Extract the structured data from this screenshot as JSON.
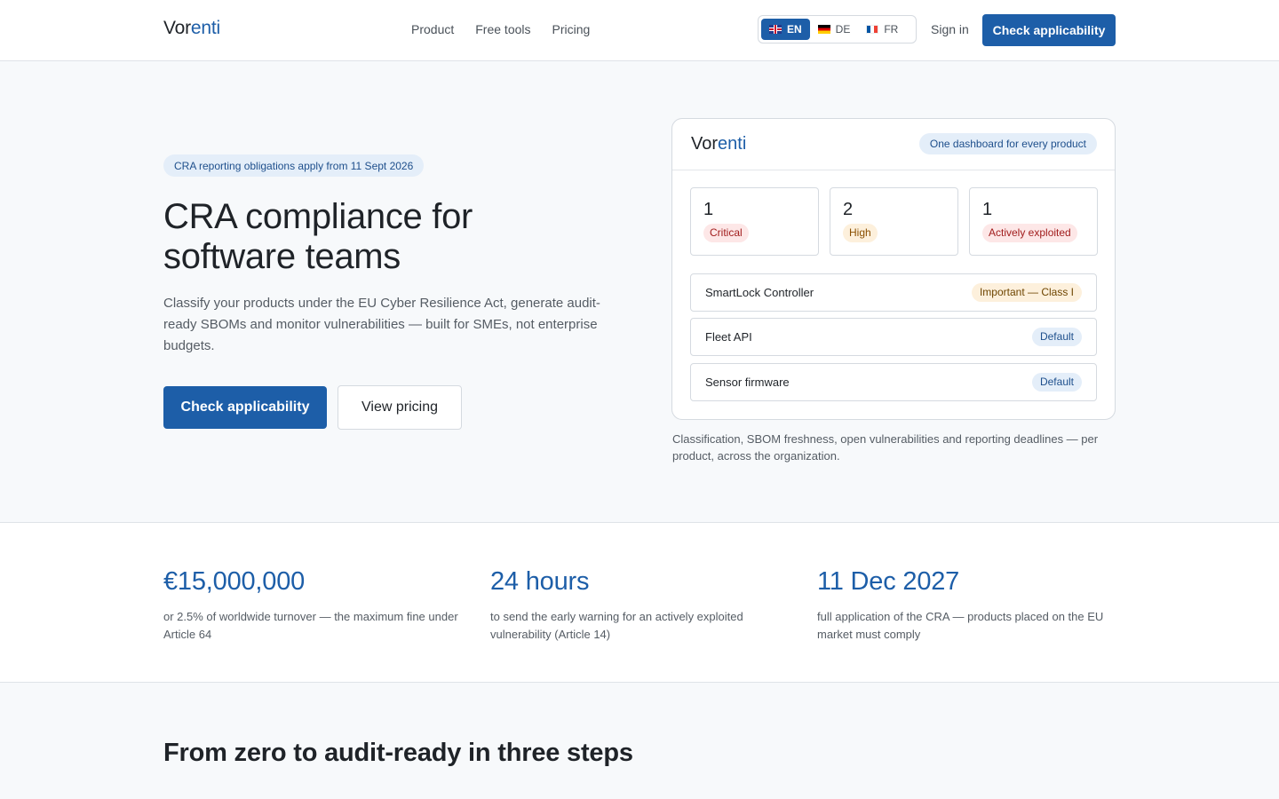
{
  "header": {
    "logo_part1": "Vor",
    "logo_part2": "enti",
    "nav": [
      "Product",
      "Free tools",
      "Pricing"
    ],
    "languages": [
      {
        "code": "EN",
        "flag": "uk-flag",
        "active": true
      },
      {
        "code": "DE",
        "flag": "de-flag",
        "active": false
      },
      {
        "code": "FR",
        "flag": "fr-flag",
        "active": false
      }
    ],
    "sign_in": "Sign in",
    "cta": "Check applicability"
  },
  "hero": {
    "pill": "CRA reporting obligations apply from 11 Sept 2026",
    "title": "CRA compliance for software teams",
    "subtitle": "Classify your products under the EU Cyber Resilience Act, generate audit-ready SBOMs and monitor vulnerabilities — built for SMEs, not enterprise budgets.",
    "primary_cta": "Check applicability",
    "secondary_cta": "View pricing"
  },
  "dashboard": {
    "logo_part1": "Vor",
    "logo_part2": "enti",
    "pill": "One dashboard for every product",
    "stats": [
      {
        "value": "1",
        "label": "Critical"
      },
      {
        "value": "2",
        "label": "High"
      },
      {
        "value": "1",
        "label": "Actively exploited"
      }
    ],
    "products": [
      {
        "name": "SmartLock Controller",
        "tag": "Important — Class I"
      },
      {
        "name": "Fleet API",
        "tag": "Default"
      },
      {
        "name": "Sensor firmware",
        "tag": "Default"
      }
    ],
    "caption": "Classification, SBOM freshness, open vulnerabilities and reporting deadlines — per product, across the organization."
  },
  "facts": [
    {
      "value": "€15,000,000",
      "text": "or 2.5% of worldwide turnover — the maximum fine under Article 64"
    },
    {
      "value": "24 hours",
      "text": "to send the early warning for an actively exploited vulnerability (Article 14)"
    },
    {
      "value": "11 Dec 2027",
      "text": "full application of the CRA — products placed on the EU market must comply"
    }
  ],
  "steps": {
    "title": "From zero to audit-ready in three steps"
  },
  "colors": {
    "brand": "#1d5ea8",
    "critical": "#a11d1d",
    "high": "#8a4f00"
  }
}
